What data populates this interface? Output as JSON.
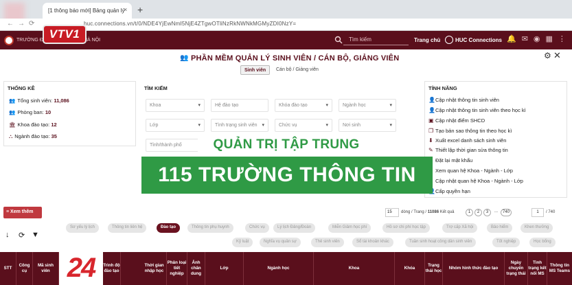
{
  "browser": {
    "tab_title": "[1 thông báo mới] Bảng quản lý",
    "tab_close": "×",
    "new_tab": "+",
    "url": "huc.connections.vn/t/0/NDE4YjEwNmI5NjE4ZTgwOTliNzRkNWNkMGMyZDI0NzY="
  },
  "header": {
    "brand": "TRƯỜNG ĐẠI HỌC VĂN HÓA HÀ NỘI",
    "search_placeholder": "Tìm kiếm",
    "home": "Trang chủ",
    "connections": "HUC Connections",
    "icons": [
      "bell-icon",
      "message-icon",
      "users-icon",
      "grid-icon",
      "more-icon"
    ]
  },
  "watermark": {
    "channel": "VTV1",
    "corner": "24"
  },
  "page": {
    "title": "PHẦN MỀM QUẢN LÝ SINH VIÊN / CÁN BỘ, GIẢNG VIÊN",
    "tabs": [
      "Sinh viên",
      "Cán bộ / Giảng viên"
    ]
  },
  "stats": {
    "title": "THỐNG KÊ",
    "items": [
      {
        "label": "Tổng sinh viên:",
        "value": "11,086"
      },
      {
        "label": "Phòng ban:",
        "value": "10"
      },
      {
        "label": "Khoa đào tạo:",
        "value": "12"
      },
      {
        "label": "Ngành đào tạo:",
        "value": "35"
      }
    ]
  },
  "search": {
    "title": "TÌM KIẾM",
    "fields": [
      "Khoa",
      "Hệ đào tạo",
      "Khóa đào tạo",
      "Ngành học",
      "Lớp",
      "Tình trạng sinh viên",
      "Chức vụ",
      "Nơi sinh",
      "Tỉnh/thành phố"
    ]
  },
  "features": {
    "title": "TÍNH NĂNG",
    "items": [
      "Cập nhật thông tin sinh viên",
      "Cập nhật thông tin sinh viên theo học kì",
      "Cập nhật điểm SHCD",
      "Tạo bản sao thông tin theo học kì",
      "Xuất excel danh sách sinh viên",
      "Thiết lập thời gian sửa thông tin",
      "Đặt lại mật khẩu",
      "Xem quan hệ Khoa - Ngành - Lớp",
      "Cập nhật quan hệ Khoa - Ngành - Lớp",
      "Cấp quyền hạn"
    ]
  },
  "captions": {
    "line1": "QUẢN TRỊ TẬP TRUNG",
    "line2": "115 TRƯỜNG THÔNG TIN"
  },
  "controls": {
    "more_button": "≡ Xem thêm",
    "page_size": "15",
    "page_info_a": "dòng / Trang / ",
    "page_info_count": "11086",
    "page_info_b": " Kết quả",
    "pages": [
      "1",
      "2",
      "3",
      "...",
      "740"
    ],
    "current_page": "1",
    "total_pages": "/ 740"
  },
  "chips": [
    "Sơ yếu lý lịch",
    "Thông tin liên hệ",
    "Đào tạo",
    "Thông tin phụ huynh",
    "Chức vụ",
    "Lý lịch Đảng/Đoàn",
    "Miễn Giảm học phí",
    "Hồ sơ chi phí học tập",
    "Trợ cấp Xã hội",
    "Bảo hiểm",
    "Khen thưởng",
    "Kỷ luật",
    "Nghĩa vụ quân sự",
    "Thẻ sinh viên",
    "Sổ tài khoản khác",
    "Tuần sinh hoạt công dân sinh viên",
    "Tốt nghiệp",
    "Học bổng"
  ],
  "active_chip": "Đào tạo",
  "table": {
    "headers": [
      "STT",
      "Công cụ",
      "Mã sinh viên",
      "",
      "Trình độ đào tạo",
      "Thời gian nhập học",
      "Phân loại tiết nghiệp",
      "Ảnh chân dung",
      "Lớp",
      "Ngành học",
      "Khoa",
      "Khóa",
      "Trạng thái học",
      "Nhóm hình thức đào tạo",
      "Ngày chuyển trạng thái",
      "Tình trạng kết nối MS",
      "Thông tin MS Teams"
    ]
  },
  "colors": {
    "brand": "#5a0f1c",
    "caption_green": "#2f9a45",
    "accent_red": "#c0393f"
  }
}
